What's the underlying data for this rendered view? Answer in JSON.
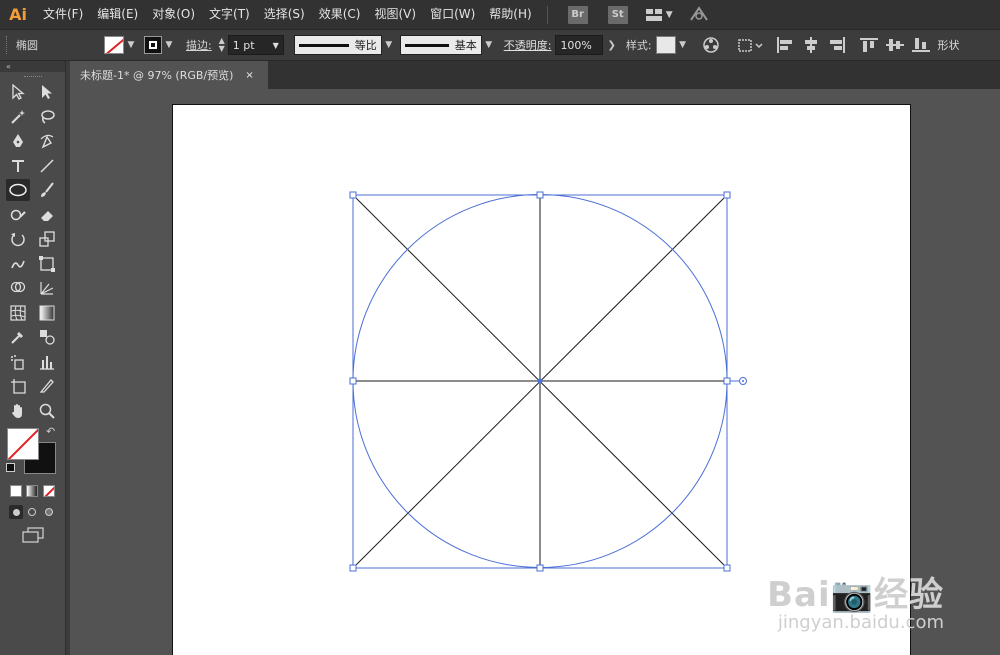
{
  "app": {
    "logo": "Ai"
  },
  "menu": [
    "文件(F)",
    "编辑(E)",
    "对象(O)",
    "文字(T)",
    "选择(S)",
    "效果(C)",
    "视图(V)",
    "窗口(W)",
    "帮助(H)"
  ],
  "app_buttons": {
    "bridge": "Br",
    "stock": "St"
  },
  "control_bar": {
    "shape_name": "椭圆",
    "stroke_label": "描边:",
    "stroke_weight": "1 pt",
    "profile_label": "等比",
    "brush_label": "基本",
    "opacity_label": "不透明度:",
    "opacity_value": "100%",
    "style_label": "样式:",
    "tail_label": "形状"
  },
  "toolbox": {
    "header": "«"
  },
  "document": {
    "tab_title": "未标题-1* @ 97% (RGB/预览)",
    "close_glyph": "×"
  },
  "colors": {
    "selection": "#4b6fd6",
    "accent_orange": "#f29d38",
    "chrome_dark": "#323232",
    "canvas": "#535353"
  },
  "watermark": {
    "brand": "Bai📷经验",
    "url": "jingyan.baidu.com"
  }
}
